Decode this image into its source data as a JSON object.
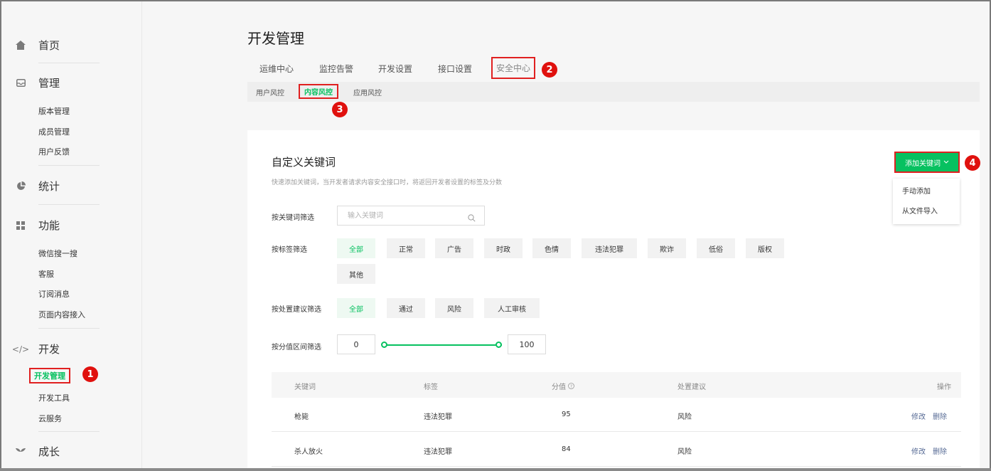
{
  "sidebar": {
    "home": "首页",
    "manage": {
      "label": "管理",
      "items": [
        "版本管理",
        "成员管理",
        "用户反馈"
      ]
    },
    "stats": "统计",
    "features": {
      "label": "功能",
      "items": [
        "微信搜一搜",
        "客服",
        "订阅消息",
        "页面内容接入"
      ]
    },
    "develop": {
      "label": "开发",
      "items": [
        "开发管理",
        "开发工具",
        "云服务"
      ]
    },
    "growth": "成长"
  },
  "header": {
    "title": "开发管理",
    "tabs": [
      "运维中心",
      "监控告警",
      "开发设置",
      "接口设置",
      "安全中心"
    ],
    "subtabs": [
      "用户风控",
      "内容风控",
      "应用风控"
    ]
  },
  "badges": [
    "1",
    "2",
    "3",
    "4"
  ],
  "card": {
    "title": "自定义关键词",
    "description": "快速添加关键词，当开发者请求内容安全接口时，将返回开发者设置的标签及分数",
    "add_button": "添加关键词",
    "dropdown": [
      "手动添加",
      "从文件导入"
    ]
  },
  "filters": {
    "keyword_label": "按关键词筛选",
    "keyword_placeholder": "输入关键词",
    "tag_label": "按标签筛选",
    "tags": [
      "全部",
      "正常",
      "广告",
      "时政",
      "色情",
      "违法犯罪",
      "欺诈",
      "低俗",
      "版权",
      "其他"
    ],
    "suggest_label": "按处置建议筛选",
    "suggestions": [
      "全部",
      "通过",
      "风险",
      "人工审核"
    ],
    "score_label": "按分值区间筛选",
    "score_min": "0",
    "score_max": "100"
  },
  "table": {
    "headers": [
      "关键词",
      "标签",
      "分值",
      "处置建议",
      "操作"
    ],
    "rows": [
      {
        "keyword": "枪毙",
        "tag": "违法犯罪",
        "score": "95",
        "suggestion": "风险",
        "edit": "修改",
        "delete": "删除"
      },
      {
        "keyword": "杀人放火",
        "tag": "违法犯罪",
        "score": "84",
        "suggestion": "风险",
        "edit": "修改",
        "delete": "删除"
      }
    ]
  },
  "colors": {
    "accent": "#07c160",
    "highlight": "#e02020",
    "link": "#576b95"
  }
}
